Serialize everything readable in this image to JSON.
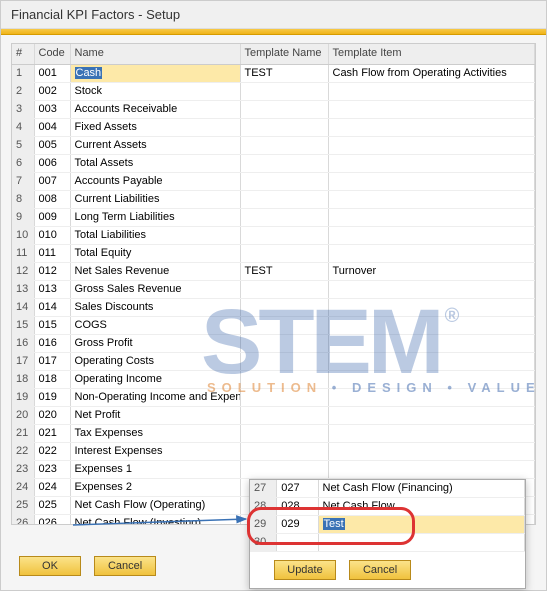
{
  "window": {
    "title": "Financial KPI Factors - Setup"
  },
  "columns": {
    "num": "#",
    "code": "Code",
    "name": "Name",
    "tname": "Template Name",
    "titem": "Template Item"
  },
  "rows": [
    {
      "n": "1",
      "code": "001",
      "name": "Cash",
      "tname": "TEST",
      "titem": "Cash Flow from Operating Activities",
      "selected": true
    },
    {
      "n": "2",
      "code": "002",
      "name": "Stock"
    },
    {
      "n": "3",
      "code": "003",
      "name": "Accounts Receivable"
    },
    {
      "n": "4",
      "code": "004",
      "name": "Fixed Assets"
    },
    {
      "n": "5",
      "code": "005",
      "name": "Current Assets"
    },
    {
      "n": "6",
      "code": "006",
      "name": "Total Assets"
    },
    {
      "n": "7",
      "code": "007",
      "name": "Accounts Payable"
    },
    {
      "n": "8",
      "code": "008",
      "name": "Current Liabilities"
    },
    {
      "n": "9",
      "code": "009",
      "name": "Long Term Liabilities"
    },
    {
      "n": "10",
      "code": "010",
      "name": "Total Liabilities"
    },
    {
      "n": "11",
      "code": "011",
      "name": "Total Equity"
    },
    {
      "n": "12",
      "code": "012",
      "name": "Net Sales Revenue",
      "tname": "TEST",
      "titem": "Turnover"
    },
    {
      "n": "13",
      "code": "013",
      "name": "Gross Sales Revenue"
    },
    {
      "n": "14",
      "code": "014",
      "name": "Sales Discounts"
    },
    {
      "n": "15",
      "code": "015",
      "name": "COGS"
    },
    {
      "n": "16",
      "code": "016",
      "name": "Gross Profit"
    },
    {
      "n": "17",
      "code": "017",
      "name": "Operating Costs"
    },
    {
      "n": "18",
      "code": "018",
      "name": "Operating Income"
    },
    {
      "n": "19",
      "code": "019",
      "name": "Non-Operating Income and Expenses"
    },
    {
      "n": "20",
      "code": "020",
      "name": "Net Profit"
    },
    {
      "n": "21",
      "code": "021",
      "name": "Tax Expenses"
    },
    {
      "n": "22",
      "code": "022",
      "name": "Interest Expenses"
    },
    {
      "n": "23",
      "code": "023",
      "name": "Expenses 1"
    },
    {
      "n": "24",
      "code": "024",
      "name": "Expenses 2"
    },
    {
      "n": "25",
      "code": "025",
      "name": "Net Cash Flow (Operating)"
    },
    {
      "n": "26",
      "code": "026",
      "name": "Net Cash Flow (Investing)"
    },
    {
      "n": "27",
      "code": "027",
      "name": "Net Cash Flow (Financing)"
    },
    {
      "n": "28",
      "code": "028",
      "name": "Net Cash Flow"
    },
    {
      "n": "29",
      "code": "",
      "name": ""
    }
  ],
  "buttons": {
    "ok": "OK",
    "cancel": "Cancel"
  },
  "popup": {
    "rows": [
      {
        "n": "27",
        "code": "027",
        "name": "Net Cash Flow (Financing)"
      },
      {
        "n": "28",
        "code": "028",
        "name": "Net Cash Flow"
      },
      {
        "n": "29",
        "code": "029",
        "name": "Test",
        "selected": true
      },
      {
        "n": "30",
        "code": "",
        "name": ""
      }
    ],
    "buttons": {
      "update": "Update",
      "cancel": "Cancel"
    }
  },
  "watermark": {
    "text": "STEM",
    "reg": "®",
    "tag_solution": "SOLUTION",
    "tag_design": "DESIGN",
    "tag_value": "VALUE",
    "dot": " • "
  }
}
